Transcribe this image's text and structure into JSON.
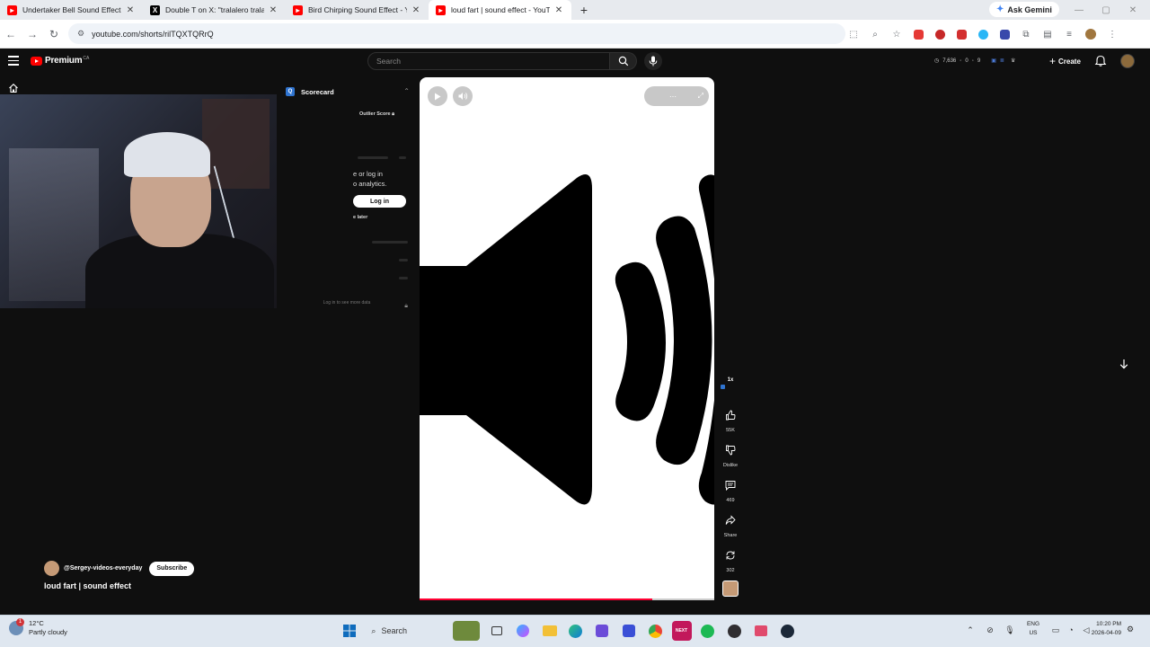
{
  "browser": {
    "tabs": [
      {
        "title": "Undertaker Bell Sound Effect -",
        "favicon": "youtube-icon",
        "active": false
      },
      {
        "title": "Double T on X: \"tralalero tralala",
        "favicon": "x-icon",
        "active": false
      },
      {
        "title": "Bird Chirping Sound Effect - Yo",
        "favicon": "youtube-icon",
        "active": false
      },
      {
        "title": "loud fart | sound effect - YouTu",
        "favicon": "youtube-icon",
        "active": true
      }
    ],
    "ask_gemini": "Ask Gemini",
    "url": "youtube.com/shorts/rilTQXTQRrQ"
  },
  "youtube": {
    "logo_text": "Premium",
    "logo_region": "CA",
    "search_placeholder": "Search",
    "header_stats": [
      "7,636",
      "0",
      "9"
    ],
    "create_label": "Create"
  },
  "scorecard": {
    "title": "Scorecard",
    "outlier_label": "Outlier Score",
    "prompt_line1": "e or log in",
    "prompt_line2": "o analytics.",
    "login_label": "Log in",
    "later_label": "e later",
    "footer": "Log in to see more data"
  },
  "short": {
    "channel": "@Sergey-videos-everyday",
    "subscribe_label": "Subscribe",
    "title": "loud fart | sound effect",
    "progress": 0.79,
    "speed_label": "1x",
    "likes": "55K",
    "dislike_label": "Dislike",
    "comments": "469",
    "share_label": "Share",
    "remix_count": "302"
  },
  "taskbar": {
    "temperature": "12°C",
    "weather": "Partly cloudy",
    "weather_badge": "1",
    "search_label": "Search",
    "lang_line1": "ENG",
    "lang_line2": "US",
    "time": "10:20 PM",
    "date": "2026-04-09"
  },
  "colors": {
    "youtube_red": "#ff0000",
    "progress_red": "#ff0033",
    "taskbar_bg": "#dfe7f0"
  }
}
